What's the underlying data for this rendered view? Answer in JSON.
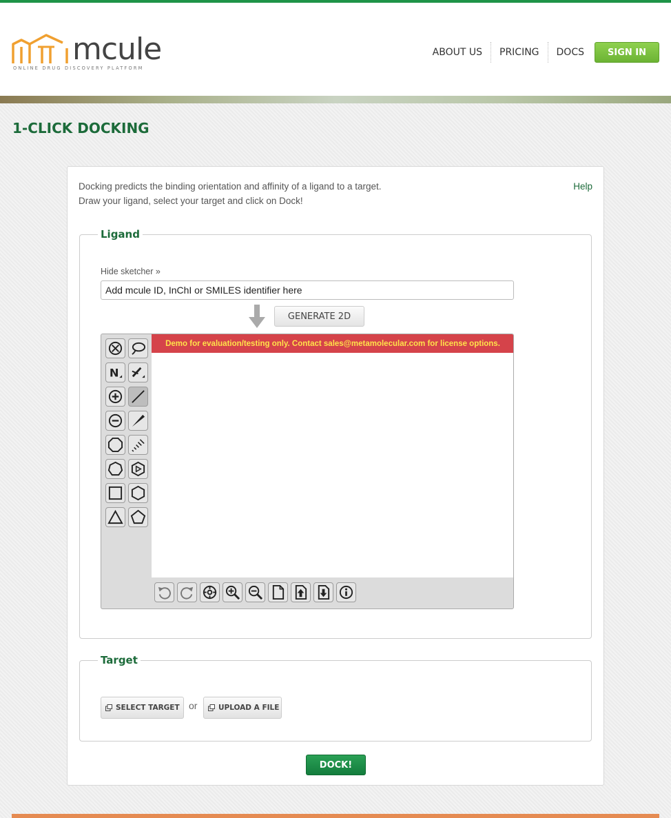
{
  "header": {
    "logo": {
      "word": "mcule",
      "tagline": "ONLINE DRUG DISCOVERY PLATFORM"
    },
    "nav": [
      {
        "label": "ABOUT US"
      },
      {
        "label": "PRICING"
      },
      {
        "label": "DOCS"
      }
    ],
    "signin_label": "SIGN IN"
  },
  "page": {
    "title": "1-CLICK DOCKING",
    "intro_line1": "Docking predicts the binding orientation and affinity of a ligand to a target.",
    "intro_line2": "Draw your ligand, select your target and click on Dock!",
    "help_label": "Help"
  },
  "ligand": {
    "title": "Ligand",
    "hide_sketcher_label": "Hide sketcher »",
    "input_placeholder": "Add mcule ID, InChI or SMILES identifier here",
    "generate_label": "GENERATE 2D",
    "demo_banner": "Demo for evaluation/testing only. Contact sales@metamolecular.com for license options.",
    "left_tools": [
      "eraser-icon",
      "lasso-icon",
      "atom-n-icon",
      "bond-toggle-icon",
      "charge-plus-icon",
      "single-bond-icon",
      "charge-minus-icon",
      "wedge-bond-icon",
      "octagon-ring-icon",
      "hash-bond-icon",
      "heptagon-ring-icon",
      "benzene-ring-icon",
      "square-ring-icon",
      "hexagon-ring-icon",
      "triangle-ring-icon",
      "pentagon-ring-icon"
    ],
    "bottom_tools": [
      "undo-icon",
      "redo-icon",
      "center-icon",
      "zoom-in-icon",
      "zoom-out-icon",
      "new-document-icon",
      "import-icon",
      "export-icon",
      "info-icon"
    ]
  },
  "target": {
    "title": "Target",
    "select_label": "SELECT TARGET",
    "or_label": "or",
    "upload_label": "UPLOAD A FILE"
  },
  "dock_label": "DOCK!",
  "colors": {
    "brand_green": "#1c6b3a",
    "signin_green": "#7cc341",
    "dock_green": "#1a8a45",
    "demo_red": "#d5434a",
    "footer_orange": "#e58b52"
  }
}
